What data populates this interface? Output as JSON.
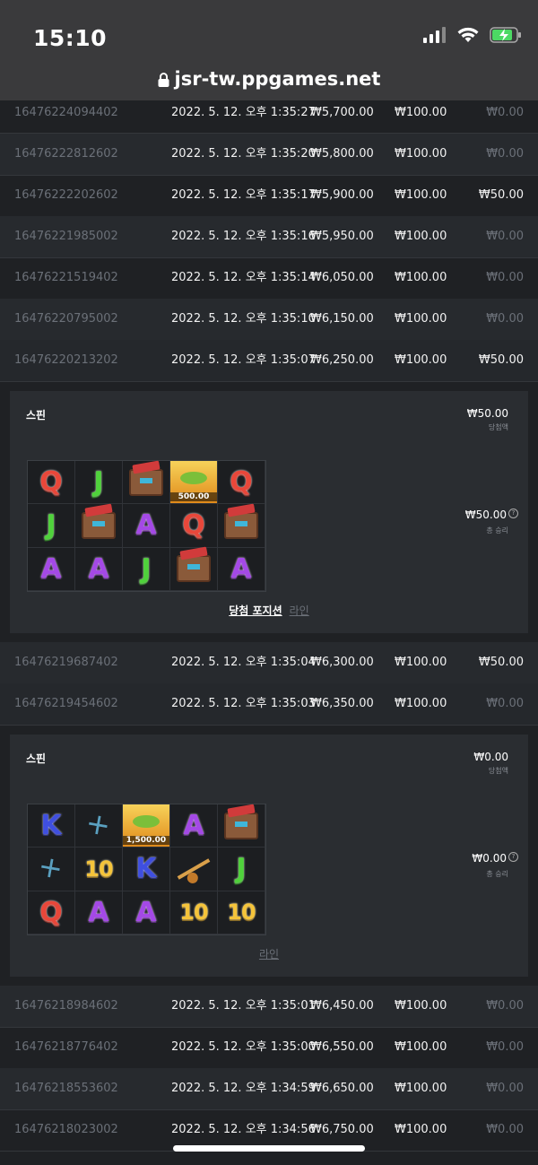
{
  "status_bar": {
    "time": "15:10"
  },
  "browser": {
    "url": "jsr-tw.ppgames.net"
  },
  "rows_top": [
    {
      "id": "16476224094402",
      "time": "2022. 5. 12. 오후 1:35:27",
      "balance": "₩5,700.00",
      "bet": "₩100.00",
      "win": "₩0.00"
    },
    {
      "id": "16476222812602",
      "time": "2022. 5. 12. 오후 1:35:20",
      "balance": "₩5,800.00",
      "bet": "₩100.00",
      "win": "₩0.00"
    },
    {
      "id": "16476222202602",
      "time": "2022. 5. 12. 오후 1:35:17",
      "balance": "₩5,900.00",
      "bet": "₩100.00",
      "win": "₩50.00"
    },
    {
      "id": "16476221985002",
      "time": "2022. 5. 12. 오후 1:35:16",
      "balance": "₩5,950.00",
      "bet": "₩100.00",
      "win": "₩0.00"
    },
    {
      "id": "16476221519402",
      "time": "2022. 5. 12. 오후 1:35:14",
      "balance": "₩6,050.00",
      "bet": "₩100.00",
      "win": "₩0.00"
    },
    {
      "id": "16476220795002",
      "time": "2022. 5. 12. 오후 1:35:10",
      "balance": "₩6,150.00",
      "bet": "₩100.00",
      "win": "₩0.00"
    },
    {
      "id": "16476220213202",
      "time": "2022. 5. 12. 오후 1:35:07",
      "balance": "₩6,250.00",
      "bet": "₩100.00",
      "win": "₩50.00"
    }
  ],
  "panel1": {
    "title": "스핀",
    "win_amount": "₩50.00",
    "win_label": "당첨액",
    "total_amount": "₩50.00",
    "total_label": "총 승리",
    "grid": [
      [
        "Q",
        "J",
        "box",
        "fish",
        "Q"
      ],
      [
        "J",
        "box",
        "A",
        "Q",
        "box"
      ],
      [
        "A",
        "A",
        "J",
        "box",
        "A"
      ]
    ],
    "fish_value": "500.00",
    "link_positions": "당첨 포지션",
    "link_lines": "라인"
  },
  "rows_mid": [
    {
      "id": "16476219687402",
      "time": "2022. 5. 12. 오후 1:35:04",
      "balance": "₩6,300.00",
      "bet": "₩100.00",
      "win": "₩50.00"
    },
    {
      "id": "16476219454602",
      "time": "2022. 5. 12. 오후 1:35:03",
      "balance": "₩6,350.00",
      "bet": "₩100.00",
      "win": "₩0.00"
    }
  ],
  "panel2": {
    "title": "스핀",
    "win_amount": "₩0.00",
    "win_label": "당첨액",
    "total_amount": "₩0.00",
    "total_label": "총 승리",
    "grid": [
      [
        "K",
        "fly",
        "fish",
        "A",
        "box"
      ],
      [
        "fly",
        "10",
        "K",
        "rod",
        "J"
      ],
      [
        "Q",
        "A",
        "A",
        "10",
        "10"
      ]
    ],
    "fish_value": "1,500.00",
    "link_lines": "라인"
  },
  "rows_bottom": [
    {
      "id": "16476218984602",
      "time": "2022. 5. 12. 오후 1:35:01",
      "balance": "₩6,450.00",
      "bet": "₩100.00",
      "win": "₩0.00"
    },
    {
      "id": "16476218776402",
      "time": "2022. 5. 12. 오후 1:35:00",
      "balance": "₩6,550.00",
      "bet": "₩100.00",
      "win": "₩0.00"
    },
    {
      "id": "16476218553602",
      "time": "2022. 5. 12. 오후 1:34:59",
      "balance": "₩6,650.00",
      "bet": "₩100.00",
      "win": "₩0.00"
    },
    {
      "id": "16476218023002",
      "time": "2022. 5. 12. 오후 1:34:56",
      "balance": "₩6,750.00",
      "bet": "₩100.00",
      "win": "₩0.00"
    }
  ],
  "colors": {
    "background": "#1f2124",
    "statusbar": "#3a3a3c",
    "panel": "#2a2d31",
    "muted_text": "#6b7078"
  }
}
